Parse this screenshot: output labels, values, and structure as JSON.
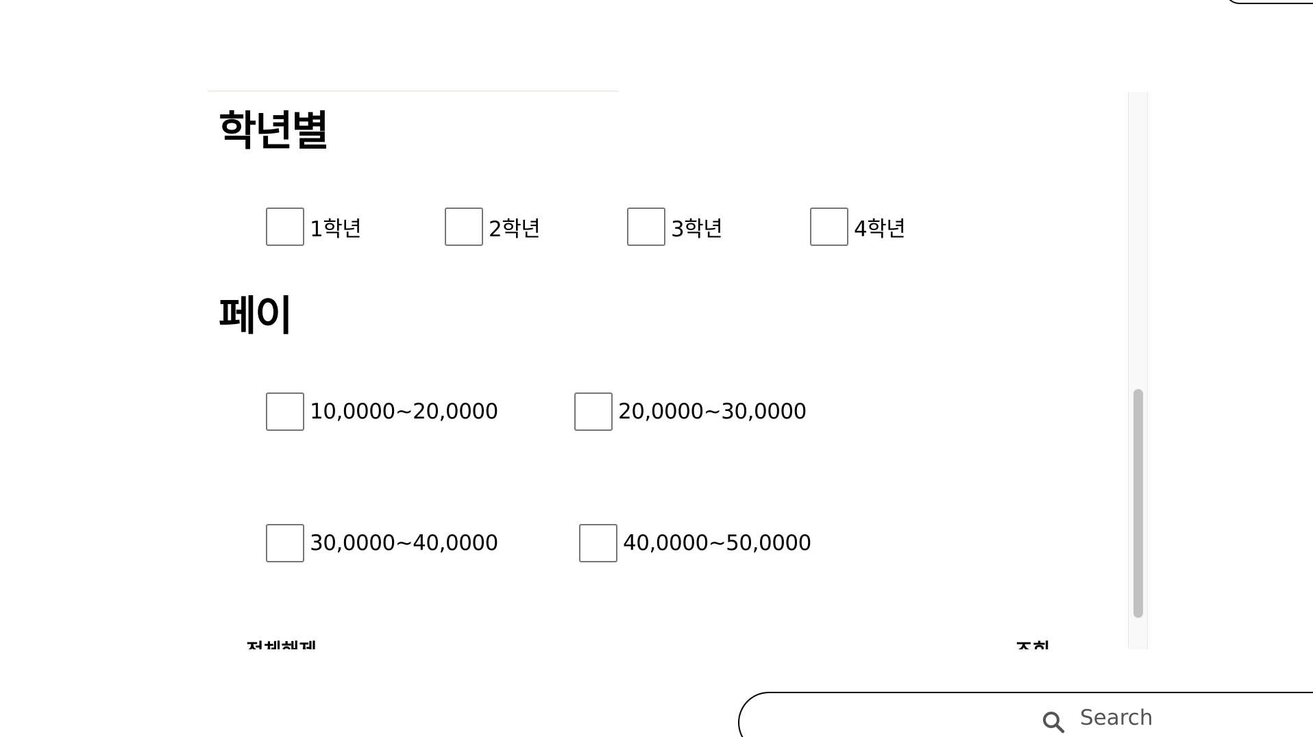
{
  "sections": [
    {
      "title": "학년별",
      "options": [
        "1학년",
        "2학년",
        "3학년",
        "4학년"
      ]
    },
    {
      "title": "페이",
      "options": [
        "10,0000~20,0000",
        "20,0000~30,0000",
        "30,0000~40,0000",
        "40,0000~50,0000"
      ]
    }
  ],
  "actions": {
    "clear_all_label": "전체해제",
    "search_label": "조회"
  },
  "search": {
    "placeholder": "Search"
  },
  "colors": {
    "checkbox_border": "#767676",
    "scrollbar_thumb": "#c1c1c1",
    "scrollbar_track": "#f8f8f8"
  }
}
